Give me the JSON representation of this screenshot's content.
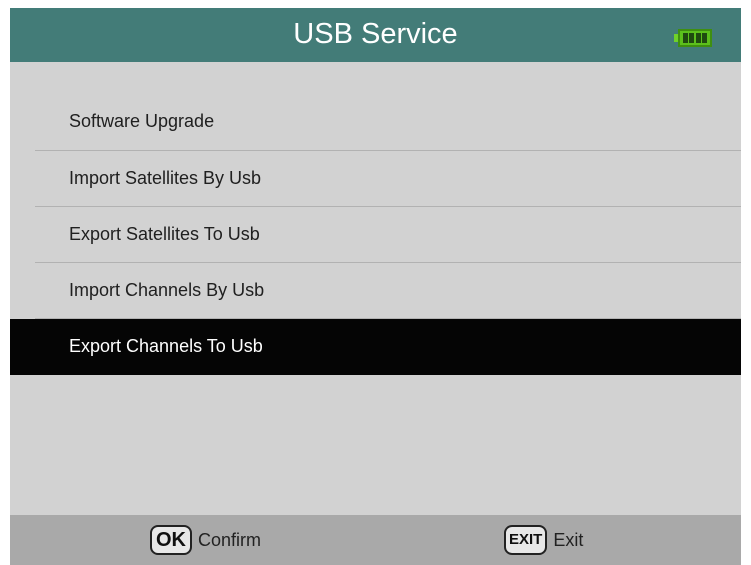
{
  "header": {
    "title": "USB Service",
    "battery_icon": "battery-full-icon",
    "battery_color": "#5cc01c",
    "level": 1.0
  },
  "menu": {
    "items": [
      {
        "label": "Software Upgrade",
        "selected": false
      },
      {
        "label": "Import Satellites By Usb",
        "selected": false
      },
      {
        "label": "Export Satellites To Usb",
        "selected": false
      },
      {
        "label": "Import Channels By Usb",
        "selected": false
      },
      {
        "label": "Export Channels To Usb",
        "selected": true
      }
    ]
  },
  "footer": {
    "confirm_key": "OK",
    "confirm_label": "Confirm",
    "exit_key": "EXIT",
    "exit_label": "Exit"
  },
  "colors": {
    "header_bg": "#437c78",
    "selected_bg": "#050505",
    "body_bg": "#d2d2d2",
    "footer_bg": "#a9a9a9"
  }
}
